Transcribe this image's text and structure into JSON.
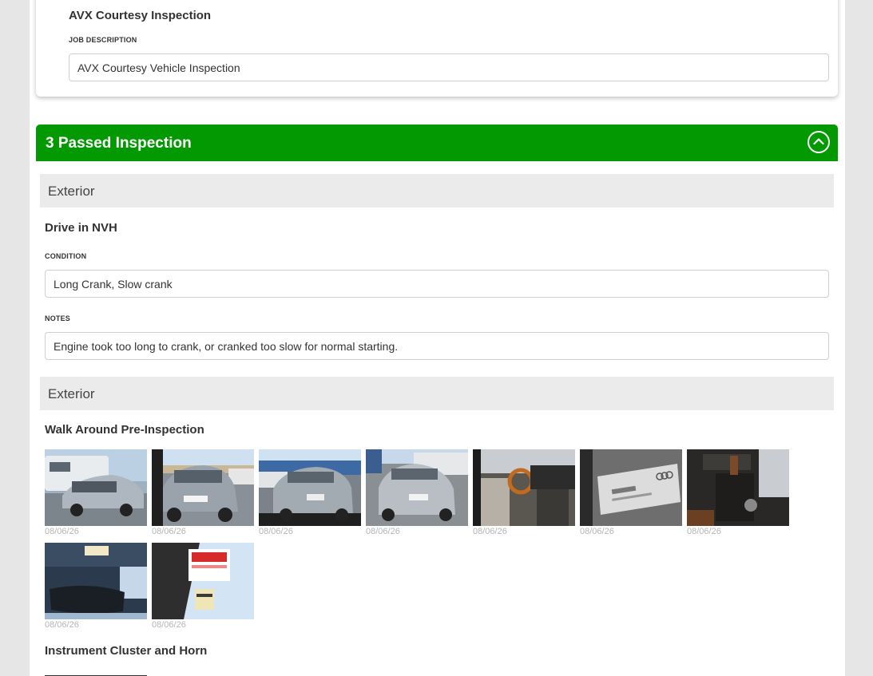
{
  "job": {
    "title": "AVX Courtesy Inspection",
    "description_label": "JOB DESCRIPTION",
    "description_value": "AVX Courtesy Vehicle Inspection"
  },
  "section": {
    "title": "3 Passed Inspection",
    "collapse_icon": "chevron-up-circle-icon",
    "color": "#029902"
  },
  "groups": [
    {
      "header": "Exterior",
      "item_title": "Drive in NVH",
      "condition_label": "CONDITION",
      "condition_value": "Long Crank, Slow crank",
      "notes_label": "NOTES",
      "notes_value": "Engine took too long to crank, or cranked too slow for normal starting."
    },
    {
      "header": "Exterior",
      "item_title": "Walk Around Pre-Inspection",
      "photos": [
        {
          "subject": "van-and-silver-sedan-photo",
          "date": "08/06/26"
        },
        {
          "subject": "silver-sedan-rear-photo",
          "date": "08/06/26"
        },
        {
          "subject": "silver-sedan-front-photo",
          "date": "08/06/26"
        },
        {
          "subject": "silver-sedan-front-angle-photo",
          "date": "08/06/26"
        },
        {
          "subject": "interior-dashboard-photo",
          "date": "08/06/26"
        },
        {
          "subject": "door-sticker-photo",
          "date": "08/06/26"
        },
        {
          "subject": "gear-shifter-photo",
          "date": "08/06/26"
        },
        {
          "subject": "headliner-light-photo",
          "date": "08/06/26"
        },
        {
          "subject": "windshield-sticker-photo",
          "date": "08/06/26"
        }
      ]
    },
    {
      "item_title": "Instrument Cluster and Horn"
    }
  ]
}
